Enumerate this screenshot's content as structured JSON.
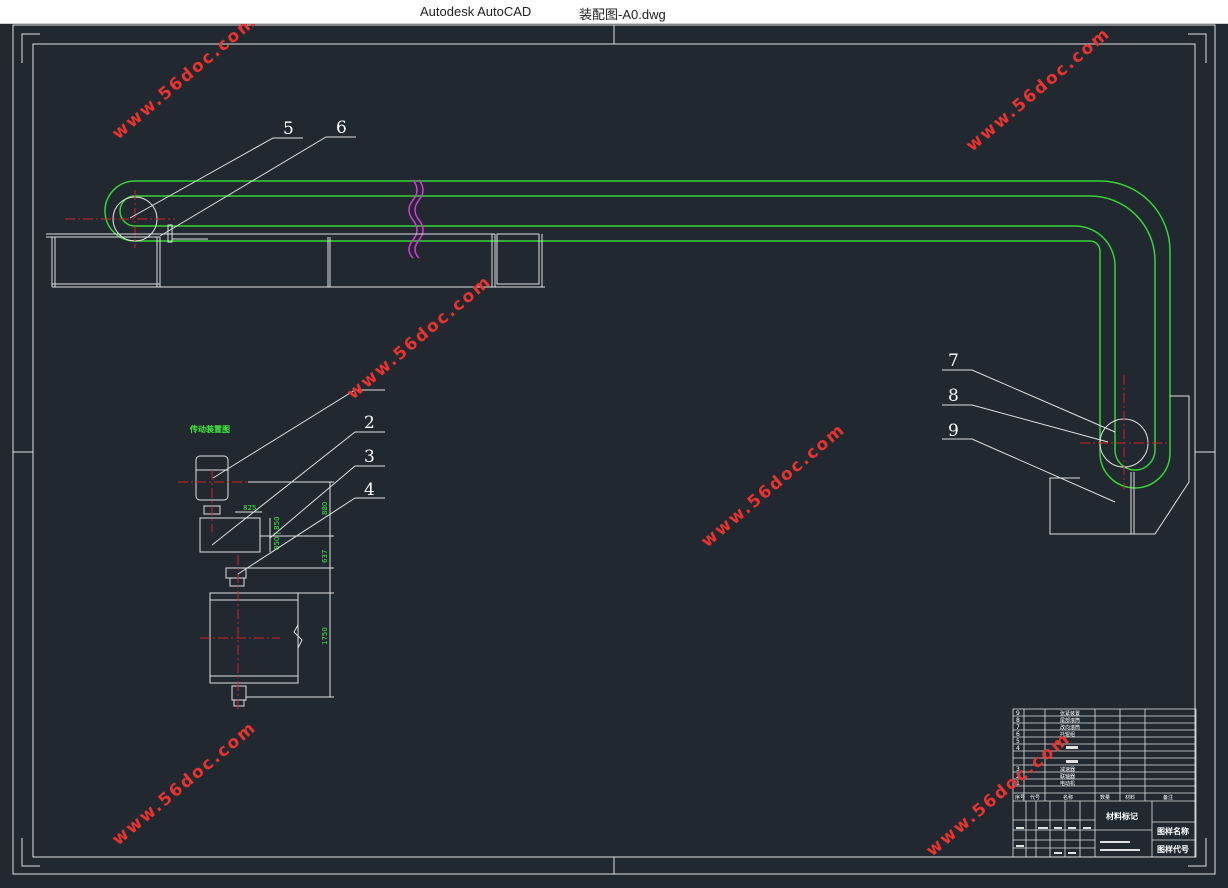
{
  "window": {
    "app_title": "Autodesk AutoCAD",
    "file_title": "装配图-A0.dwg"
  },
  "drawing": {
    "part_labels": [
      "5",
      "6",
      "2",
      "3",
      "4",
      "7",
      "8",
      "9"
    ],
    "drive_label": "传动装置图",
    "dimensions": {
      "d1": "825",
      "d2": "850 | 850",
      "d3": "880",
      "d4": "637",
      "d5": "1750"
    },
    "watermark": "www.56doc.com"
  },
  "title_block": {
    "rows": [
      {
        "no": "9",
        "name": "张紧装置"
      },
      {
        "no": "8",
        "name": "尾部滚筒"
      },
      {
        "no": "7",
        "name": "改向滚筒"
      },
      {
        "no": "6",
        "name": "托辊组"
      },
      {
        "no": "5",
        "name": ""
      },
      {
        "no": "4",
        "name": ""
      },
      {
        "no": "3",
        "name": "减速器"
      },
      {
        "no": "2",
        "name": "联轴器"
      },
      {
        "no": "1",
        "name": "电动机"
      }
    ],
    "header": {
      "no": "序号",
      "code": "代号",
      "name": "名称",
      "qty": "数量",
      "material": "材料",
      "remark": "备注"
    },
    "material_mark": "材料标记",
    "drawing_name": "图样名称",
    "drawing_code": "图样代号"
  }
}
